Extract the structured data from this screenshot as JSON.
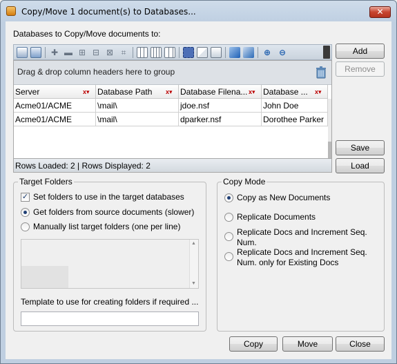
{
  "window": {
    "title": "Copy/Move 1 document(s) to Databases...",
    "close_glyph": "✕"
  },
  "databases": {
    "label": "Databases to Copy/Move documents to:",
    "group_hint": "Drag & drop column headers here to group",
    "columns": [
      "Server",
      "Database Path",
      "Database Filena...",
      "Database ..."
    ],
    "rows": [
      [
        "Acme01/ACME",
        "\\mail\\",
        "jdoe.nsf",
        "John Doe"
      ],
      [
        "Acme01/ACME",
        "\\mail\\",
        "dparker.nsf",
        "Dorothee Parker"
      ]
    ],
    "status": "Rows Loaded: 2  |  Rows Displayed: 2"
  },
  "side_buttons": {
    "add": "Add",
    "remove": "Remove",
    "save": "Save",
    "load": "Load"
  },
  "target_folders": {
    "title": "Target Folders",
    "set_folders": "Set folders to use in the target databases",
    "from_source": "Get folders from source documents (slower)",
    "manual": "Manually list target folders (one per line)",
    "template_label": "Template to use for creating folders if required ...",
    "template_value": ""
  },
  "copy_mode": {
    "title": "Copy Mode",
    "options": [
      "Copy as New Documents",
      "Replicate Documents",
      "Replicate Docs and Increment Seq. Num.",
      "Replicate Docs and Increment Seq. Num. only for Existing Docs"
    ],
    "option3_line1": "Replicate Docs and Increment Seq.",
    "option3_line2": "Num.",
    "option4_line1": "Replicate Docs and Increment Seq.",
    "option4_line2": "Num. only for Existing Docs"
  },
  "footer": {
    "copy": "Copy",
    "move": "Move",
    "close": "Close"
  },
  "colors": {
    "title_gradient_top": "#cfdcea",
    "close_red": "#c8442f",
    "radio_dot": "#1f3f75"
  }
}
